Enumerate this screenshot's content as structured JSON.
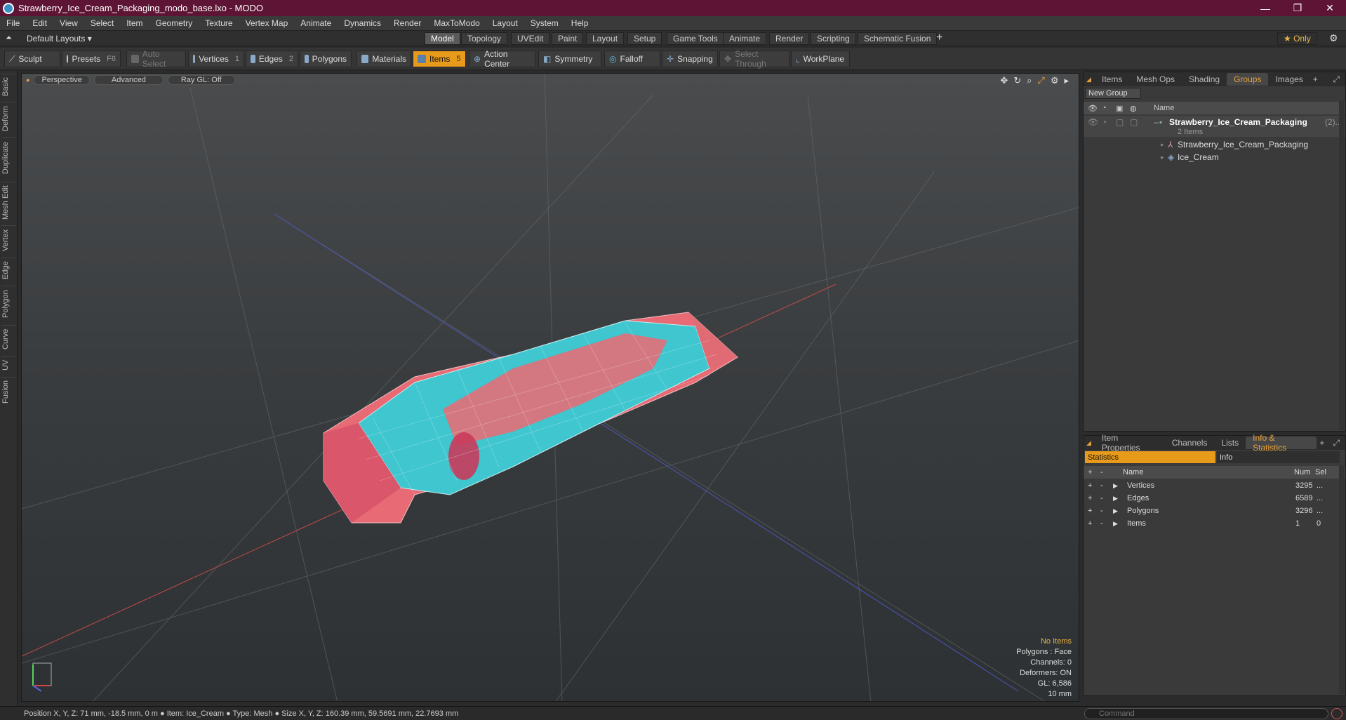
{
  "window": {
    "title": "Strawberry_Ice_Cream_Packaging_modo_base.lxo - MODO",
    "minimize": "—",
    "maximize": "❐",
    "close": "✕"
  },
  "menu": [
    "File",
    "Edit",
    "View",
    "Select",
    "Item",
    "Geometry",
    "Texture",
    "Vertex Map",
    "Animate",
    "Dynamics",
    "Render",
    "MaxToModo",
    "Layout",
    "System",
    "Help"
  ],
  "layouts": {
    "default_label": "Default Layouts ▾",
    "tabs": [
      "Model",
      "Topology",
      "UVEdit",
      "Paint",
      "Layout",
      "Setup",
      "Game Tools",
      "Animate",
      "Render",
      "Scripting",
      "Schematic Fusion"
    ],
    "active": "Model",
    "add": "+",
    "only": "★  Only",
    "settings": "⚙"
  },
  "toolbar": {
    "sculpt": "Sculpt",
    "presets": "Presets",
    "presets_key": "F6",
    "auto_select": "Auto Select",
    "vertices": "Vertices",
    "vertices_num": "1",
    "edges": "Edges",
    "edges_num": "2",
    "polygons": "Polygons",
    "materials": "Materials",
    "items": "Items",
    "items_num": "5",
    "action_center": "Action Center",
    "symmetry": "Symmetry",
    "falloff": "Falloff",
    "snapping": "Snapping",
    "select_through": "Select Through",
    "workplane": "WorkPlane"
  },
  "left_tabs": [
    "Basic",
    "Deform",
    "Duplicate",
    "Mesh Edit",
    "Vertex",
    "Edge",
    "Polygon",
    "Curve",
    "UV",
    "Fusion"
  ],
  "viewport": {
    "view": "Perspective",
    "advanced": "Advanced",
    "raygl": "Ray GL: Off",
    "stats": {
      "items": "No Items",
      "polygons": "Polygons : Face",
      "channels": "Channels: 0",
      "deformers": "Deformers: ON",
      "gl": "GL: 6,586",
      "scale": "10 mm"
    }
  },
  "groups_panel": {
    "tabs": [
      "Items",
      "Mesh Ops",
      "Shading",
      "Groups",
      "Images"
    ],
    "active": "Groups",
    "new_group": "New Group",
    "name_header": "Name",
    "group_name": "Strawberry_Ice_Cream_Packaging",
    "group_suffix": "(2)...",
    "group_count": "2 Items",
    "children": [
      "Strawberry_Ice_Cream_Packaging",
      "Ice_Cream"
    ]
  },
  "stats_panel": {
    "tabs": [
      "Item Properties",
      "Channels",
      "Lists",
      "Info & Statistics"
    ],
    "active": "Info & Statistics",
    "sub_statistics": "Statistics",
    "sub_info": "Info",
    "headers": {
      "plus": "+",
      "minus": "-",
      "name": "Name",
      "num": "Num",
      "sel": "Sel"
    },
    "rows": [
      {
        "name": "Vertices",
        "num": "3295",
        "sel": "..."
      },
      {
        "name": "Edges",
        "num": "6589",
        "sel": "..."
      },
      {
        "name": "Polygons",
        "num": "3296",
        "sel": "..."
      },
      {
        "name": "Items",
        "num": "1",
        "sel": "0"
      }
    ]
  },
  "status": {
    "text": "Position X, Y, Z:   71 mm, -18.5 mm, 0 m  ●  Item:  Ice_Cream  ●  Type:  Mesh  ●  Size X, Y, Z:   160.39 mm, 59.5691 mm, 22.7693 mm",
    "command_placeholder": "Command"
  }
}
